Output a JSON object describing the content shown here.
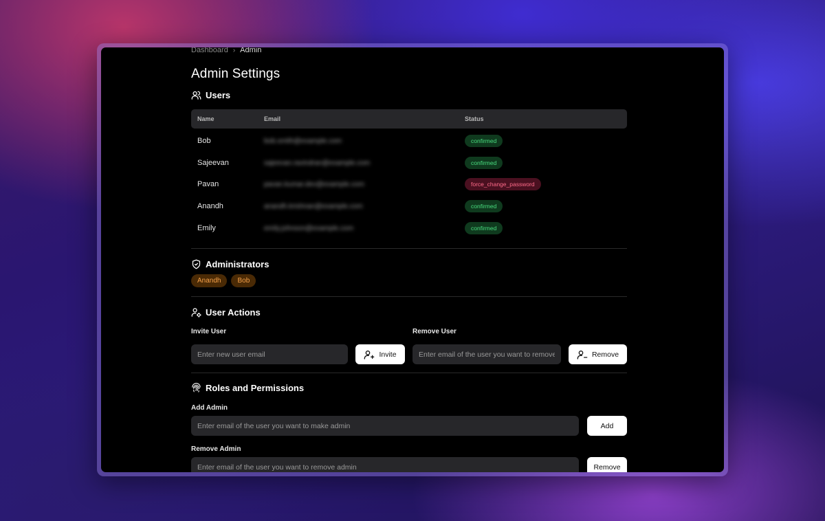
{
  "breadcrumb": {
    "items": [
      "Dashboard",
      "Admin"
    ],
    "separator": "›"
  },
  "page_title": "Admin Settings",
  "users": {
    "title": "Users",
    "columns": [
      "Name",
      "Email",
      "Status"
    ],
    "rows": [
      {
        "name": "Bob",
        "email": "bob.smith@example.com",
        "status": "confirmed"
      },
      {
        "name": "Sajeevan",
        "email": "sajeevan.ravindran@example.com",
        "status": "confirmed"
      },
      {
        "name": "Pavan",
        "email": "pavan.kumar.dev@example.com",
        "status": "force_change_password"
      },
      {
        "name": "Anandh",
        "email": "anandh.krishnan@example.com",
        "status": "confirmed"
      },
      {
        "name": "Emily",
        "email": "emily.johnson@example.com",
        "status": "confirmed"
      }
    ]
  },
  "administrators": {
    "title": "Administrators",
    "list": [
      "Anandh",
      "Bob"
    ]
  },
  "user_actions": {
    "title": "User Actions",
    "invite": {
      "label": "Invite User",
      "placeholder": "Enter new user email",
      "button": "Invite"
    },
    "remove": {
      "label": "Remove User",
      "placeholder": "Enter email of the user you want to remove",
      "button": "Remove"
    }
  },
  "roles": {
    "title": "Roles and Permissions",
    "add_admin": {
      "label": "Add Admin",
      "placeholder": "Enter email of the user you want to make admin",
      "button": "Add"
    },
    "remove_admin": {
      "label": "Remove Admin",
      "placeholder": "Enter email of the user you want to remove admin",
      "button": "Remove"
    }
  },
  "colors": {
    "confirmed_badge_bg": "#0f3a1e",
    "confirmed_badge_text": "#4ade80",
    "danger_badge_bg": "#4a1020",
    "danger_badge_text": "#ff6b8a",
    "admin_chip_bg": "#4a2a05",
    "admin_chip_text": "#f5a14a"
  },
  "icons": [
    "users-icon",
    "shield-icon",
    "user-cog-icon",
    "user-plus-icon",
    "user-minus-icon",
    "fingerprint-icon",
    "chevron-right-icon"
  ]
}
